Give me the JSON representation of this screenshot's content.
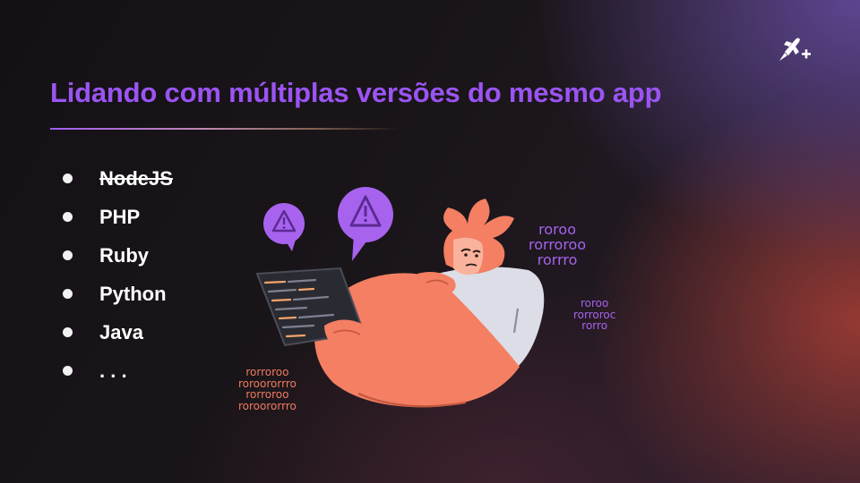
{
  "slide": {
    "title": "Lidando com múltiplas versões do mesmo app",
    "bullets": [
      {
        "label": "NodeJS",
        "struck": true
      },
      {
        "label": "PHP",
        "struck": false
      },
      {
        "label": "Ruby",
        "struck": false
      },
      {
        "label": "Python",
        "struck": false
      },
      {
        "label": "Java",
        "struck": false
      },
      {
        "label": ". . .",
        "struck": false
      }
    ]
  },
  "illustration": {
    "code_right_top": [
      "roroo",
      "rorroroo",
      "rorrro"
    ],
    "code_right_mid": [
      "roroo",
      "rorroroc",
      "rorro"
    ],
    "code_bottom_left": [
      "rorroroo",
      "roroororrro",
      "rorroroo",
      "roroororrro"
    ],
    "icons": [
      "warning-icon",
      "warning-icon"
    ]
  },
  "colors": {
    "title": "#9b54f2",
    "accent_orange": "#f47f62",
    "bubble_purple": "#a763ee",
    "shirt": "#dcdde6"
  }
}
